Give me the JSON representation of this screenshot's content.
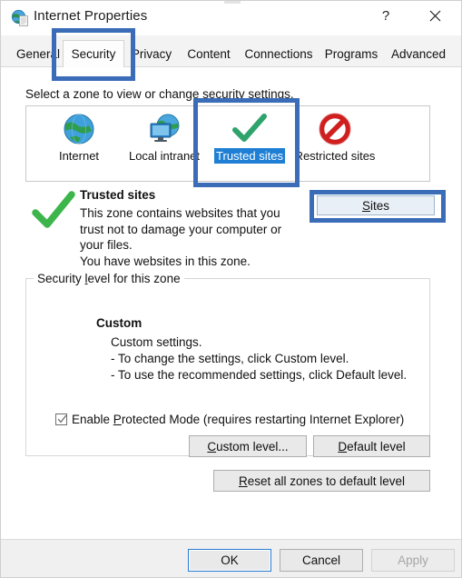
{
  "window": {
    "title": "Internet Properties",
    "icon": "internet-properties-globe-icon",
    "help_label": "?",
    "close_label": "✕"
  },
  "tabs": [
    {
      "label": "General",
      "active": false
    },
    {
      "label": "Security",
      "active": true
    },
    {
      "label": "Privacy",
      "active": false
    },
    {
      "label": "Content",
      "active": false
    },
    {
      "label": "Connections",
      "active": false
    },
    {
      "label": "Programs",
      "active": false
    },
    {
      "label": "Advanced",
      "active": false
    }
  ],
  "security": {
    "zone_prompt": "Select a zone to view or change security settings.",
    "zones": [
      {
        "label": "Internet",
        "icon": "globe-icon",
        "selected": false
      },
      {
        "label": "Local intranet",
        "icon": "globe-monitor-icon",
        "selected": false
      },
      {
        "label": "Trusted sites",
        "icon": "green-check-icon",
        "selected": true
      },
      {
        "label": "Restricted sites",
        "icon": "red-prohibited-icon",
        "selected": false
      }
    ],
    "description": {
      "icon": "green-check-icon",
      "title": "Trusted sites",
      "lines": [
        "This zone contains websites that you",
        "trust not to damage your computer or",
        "your files.",
        "You have websites in this zone."
      ]
    },
    "sites_button": "Sites",
    "level_group_title": "Security level for this zone",
    "level_name": "Custom",
    "level_lines": [
      "Custom settings.",
      "- To change the settings, click Custom level.",
      "- To use the recommended settings, click Default level."
    ],
    "protected_mode": {
      "label": "Enable Protected Mode (requires restarting Internet Explorer)",
      "checked": true
    },
    "custom_level_button": "Custom level...",
    "default_level_button": "Default level",
    "reset_button": "Reset all zones to default level"
  },
  "footer": {
    "ok": "OK",
    "cancel": "Cancel",
    "apply": "Apply",
    "apply_enabled": false
  },
  "annotations": {
    "accent_color": "#3a6cb8",
    "targets": [
      "security-tab",
      "trusted-sites-zone",
      "sites-button"
    ]
  },
  "colors": {
    "selection_blue": "#1e7fd4",
    "annotation_blue": "#3a6cb8",
    "dialog_grey": "#f0f0f0",
    "button_grey": "#e9e9e9"
  }
}
